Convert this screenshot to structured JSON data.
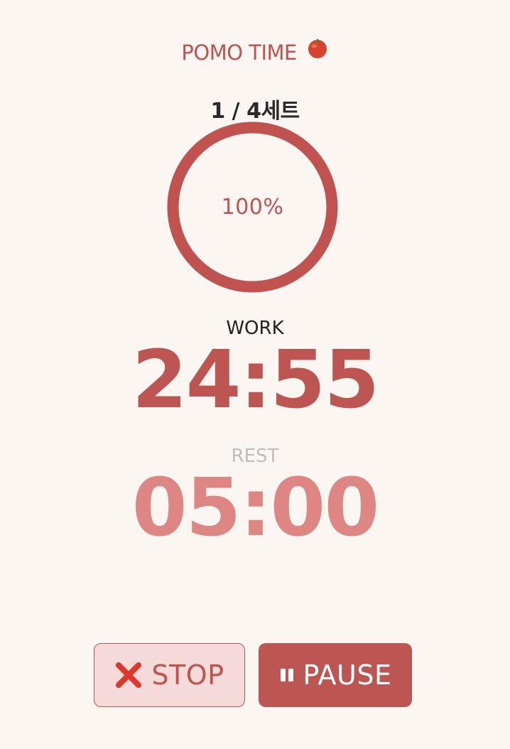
{
  "header": {
    "title": "POMO TIME",
    "title_icon": "tomato-icon"
  },
  "session": {
    "set_counter": "1 / 4세트",
    "current_set": 1,
    "total_sets": 4
  },
  "progress": {
    "percent_label": "100%",
    "percent_value": 100
  },
  "work": {
    "label": "WORK",
    "time": "24:55"
  },
  "rest": {
    "label": "REST",
    "time": "05:00"
  },
  "controls": {
    "stop": {
      "label": "STOP",
      "icon": "cross-icon"
    },
    "pause": {
      "label": "PAUSE",
      "icon": "pause-icon"
    }
  },
  "colors": {
    "background": "#fcf6f3",
    "accent": "#c0524f",
    "work_time": "#bd5552",
    "rest_time": "#dd8684",
    "stop_button_bg": "#f4dad8",
    "stop_cross": "#e0372d"
  }
}
